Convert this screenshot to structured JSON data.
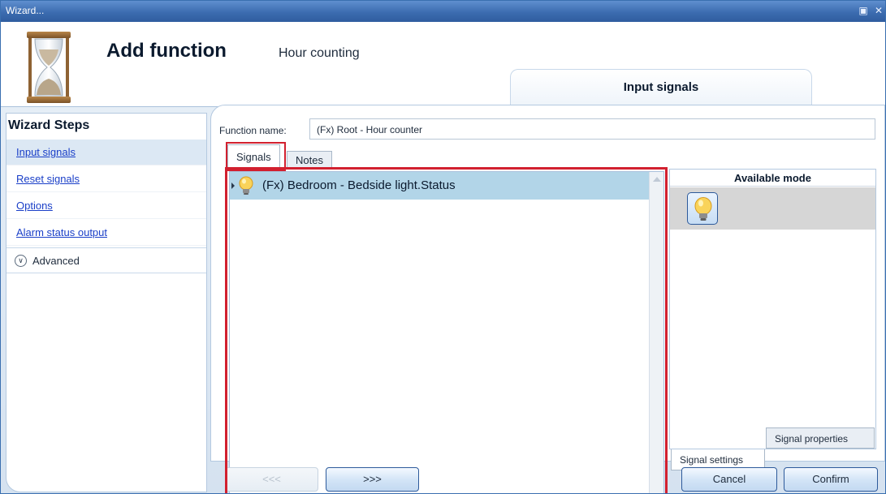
{
  "window": {
    "title": "Wizard...",
    "restore_icon": "restore-icon",
    "close_icon": "close-icon"
  },
  "header": {
    "title": "Add function",
    "subtitle": "Hour counting",
    "current_step": "Input signals",
    "icon": "hourglass-icon"
  },
  "sidebar": {
    "title": "Wizard Steps",
    "items": [
      {
        "label": "Input signals",
        "active": true
      },
      {
        "label": "Reset signals"
      },
      {
        "label": "Options"
      },
      {
        "label": "Alarm status output"
      }
    ],
    "advanced_label": "Advanced"
  },
  "main": {
    "function_name_label": "Function name:",
    "function_name_value": "(Fx) Root - Hour counter",
    "tabs": [
      {
        "label": "Signals",
        "active": true
      },
      {
        "label": "Notes"
      }
    ],
    "signals": [
      {
        "label": "(Fx) Bedroom - Bedside light.Status",
        "icon": "lightbulb-icon"
      }
    ],
    "mode_panel": {
      "header": "Available mode",
      "mode_icon": "lightbulb-icon",
      "bottom_tabs": [
        {
          "label": "Signal settings",
          "active": true
        },
        {
          "label": "Signal properties"
        }
      ]
    }
  },
  "footer": {
    "back_label": "<<<",
    "next_label": ">>>",
    "cancel_label": "Cancel",
    "confirm_label": "Confirm"
  },
  "colors": {
    "title_bar": "#3c6cb0",
    "highlight_frame": "#d2202f",
    "selected_row": "#b2d5e8",
    "link": "#1a3fc8"
  }
}
